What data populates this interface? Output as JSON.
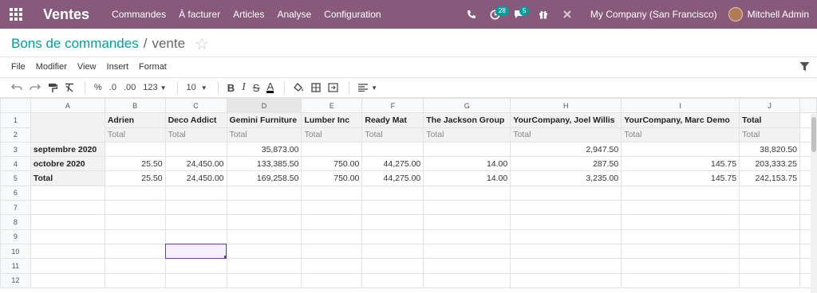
{
  "navbar": {
    "app_name": "Ventes",
    "menu": [
      "Commandes",
      "À facturer",
      "Articles",
      "Analyse",
      "Configuration"
    ],
    "activity_badge": "28",
    "messages_badge": "5",
    "company": "My Company (San Francisco)",
    "user": "Mitchell Admin",
    "accent": "#875a7b"
  },
  "breadcrumb": {
    "parent": "Bons de commandes",
    "separator": "/",
    "current": "vente"
  },
  "menubar": [
    "File",
    "Modifier",
    "View",
    "Insert",
    "Format"
  ],
  "toolbar": {
    "percent": "%",
    "dec_less": ".0",
    "dec_more": ".00",
    "number_format": "123",
    "font_size": "10",
    "bold": "B",
    "italic": "I",
    "strike": "S",
    "text_color": "A"
  },
  "sheet": {
    "columns": [
      "A",
      "B",
      "C",
      "D",
      "E",
      "F",
      "G",
      "H",
      "I",
      "J"
    ],
    "header_row": [
      "",
      "Adrien",
      "Deco Addict",
      "Gemini Furniture",
      "Lumber Inc",
      "Ready Mat",
      "The Jackson Group",
      "YourCompany, Joel Willis",
      "YourCompany, Marc Demo",
      "Total"
    ],
    "measure_row": [
      "",
      "Total",
      "Total",
      "Total",
      "Total",
      "Total",
      "Total",
      "Total",
      "Total",
      "Total"
    ],
    "data_rows": [
      [
        "septembre 2020",
        "",
        "",
        "35,873.00",
        "",
        "",
        "",
        "2,947.50",
        "",
        "38,820.50"
      ],
      [
        "octobre 2020",
        "25.50",
        "24,450.00",
        "133,385.50",
        "750.00",
        "44,275.00",
        "14.00",
        "287.50",
        "145.75",
        "203,333.25"
      ],
      [
        "Total",
        "25.50",
        "24,450.00",
        "169,258.50",
        "750.00",
        "44,275.00",
        "14.00",
        "3,235.00",
        "145.75",
        "242,153.75"
      ]
    ],
    "row_numbers": [
      "1",
      "2",
      "3",
      "4",
      "5",
      "6",
      "7",
      "8",
      "9",
      "10",
      "11",
      "12"
    ],
    "selected_cell": "D10"
  }
}
